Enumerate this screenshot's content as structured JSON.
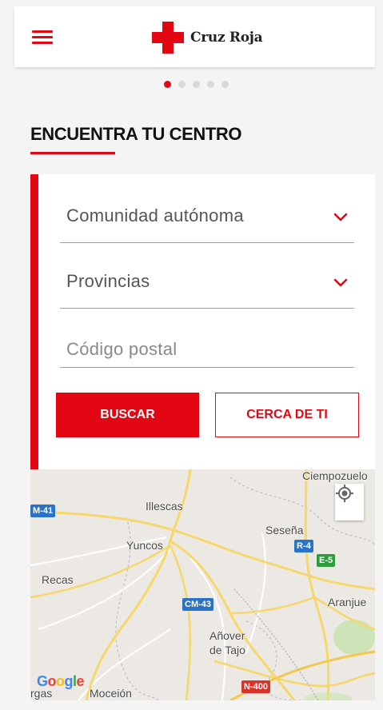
{
  "header": {
    "menu_icon": "hamburger-menu-icon",
    "logo_text": "Cruz Roja",
    "logo_icon": "red-cross-icon",
    "brand_color": "#e30613"
  },
  "carousel": {
    "dot_count": 5,
    "active_index": 0
  },
  "section": {
    "title": "ENCUENTRA TU CENTRO"
  },
  "form": {
    "region_select": {
      "value": "Comunidad autónoma",
      "icon": "chevron-down-icon"
    },
    "province_select": {
      "value": "Provincias",
      "icon": "chevron-down-icon"
    },
    "postal_code": {
      "placeholder": "Código postal",
      "value": ""
    },
    "search_button": "BUSCAR",
    "near_button": "CERCA DE TI"
  },
  "map": {
    "locate_icon": "my-location-icon",
    "places": [
      "Ciempozuelo",
      "Illescas",
      "Seseña",
      "Yuncos",
      "Recas",
      "Aranjue",
      "Añover",
      "de Tajo",
      "rgas",
      "Moceión"
    ],
    "roads": [
      "M-41",
      "R-4",
      "E-5",
      "CM-43",
      "N-400"
    ],
    "attribution": "Google"
  }
}
